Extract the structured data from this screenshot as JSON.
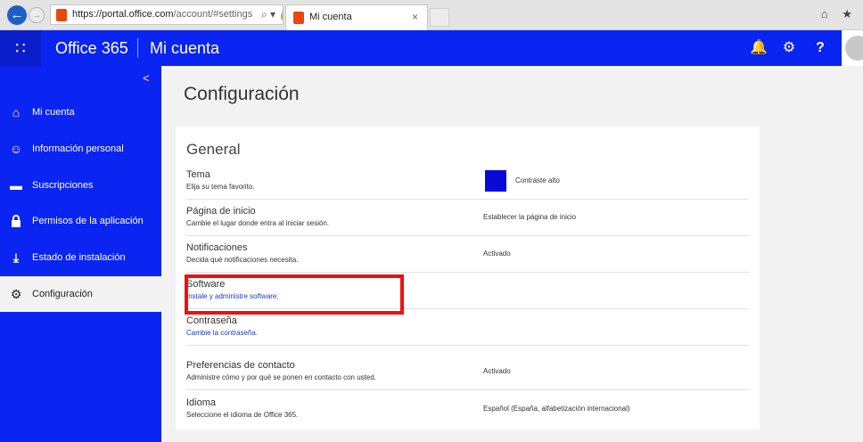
{
  "browser": {
    "url_domain": "https://portal.office.com",
    "url_path": "/account/#settings",
    "address_tools": "⌕ ▾ 🔒 ↻",
    "tab_title": "Mi cuenta",
    "tab_close": "×",
    "back": "←",
    "forward": "→",
    "right_icons": "⌂ ★"
  },
  "suite": {
    "brand": "Office 365",
    "title": "Mi cuenta",
    "buttons": {
      "notifications": "🔔",
      "settings": "⚙",
      "help": "?"
    },
    "accent": "#0a24f1"
  },
  "sidebar": {
    "collapse": "<",
    "items": [
      {
        "label": "Mi cuenta",
        "icon": "home-icon",
        "glyph": "⌂"
      },
      {
        "label": "Información personal",
        "icon": "person-icon",
        "glyph": "☺"
      },
      {
        "label": "Suscripciones",
        "icon": "card-icon",
        "glyph": "▬"
      },
      {
        "label": "Permisos de la aplicación",
        "icon": "lock-icon",
        "glyph": "⌂"
      },
      {
        "label": "Estado de instalación",
        "icon": "download-icon",
        "glyph": "⤓"
      },
      {
        "label": "Configuración",
        "icon": "gear-icon",
        "glyph": "⚙"
      }
    ]
  },
  "main": {
    "page_title": "Configuración",
    "section_title": "General",
    "rows": [
      {
        "name": "Tema",
        "desc": "Elija su tema favorito.",
        "value": "Contraste alto",
        "swatch_color": "#0a0ad8"
      },
      {
        "name": "Página de inicio",
        "desc": "Cambie el lugar donde entra al iniciar sesión.",
        "value": "Establecer la página de inicio"
      },
      {
        "name": "Notificaciones",
        "desc": "Decida qué notificaciones necesita.",
        "value": "Activado"
      },
      {
        "name": "Software",
        "desc": "Instale y administre software.",
        "value": ""
      },
      {
        "name": "Contraseña",
        "desc": "Cambie la contraseña.",
        "value": ""
      },
      {
        "name": "Preferencias de contacto",
        "desc": "Administre cómo y por qué se ponen en contacto con usted.",
        "value": "Activado"
      },
      {
        "name": "Idioma",
        "desc": "Seleccione el idioma de Office 365.",
        "value": "Español (España, alfabetización internacional)"
      }
    ]
  }
}
